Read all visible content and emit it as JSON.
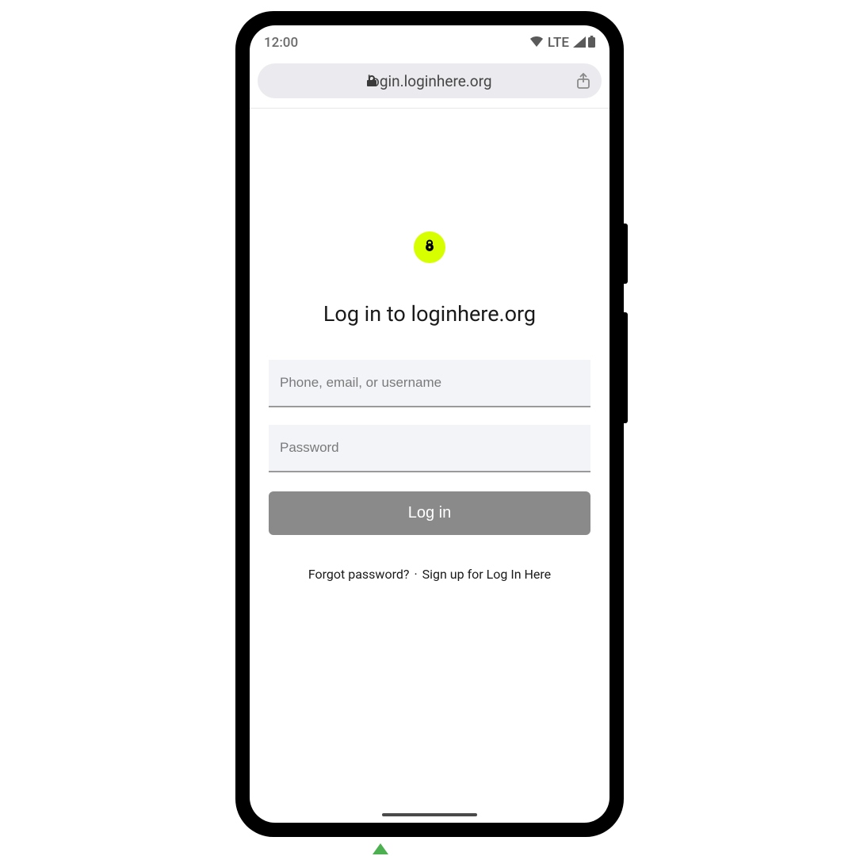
{
  "status_bar": {
    "time": "12:00",
    "network_label": "LTE"
  },
  "address_bar": {
    "url": "login.loginhere.org"
  },
  "icons": {
    "lock": "lock-icon",
    "share": "share-icon",
    "wifi": "wifi-icon",
    "signal": "cell-signal-icon",
    "battery": "battery-icon",
    "logo_lock": "logo-lock-icon"
  },
  "login_form": {
    "title": "Log in to loginhere.org",
    "username_placeholder": "Phone, email, or username",
    "password_placeholder": "Password",
    "submit_label": "Log in"
  },
  "footer": {
    "forgot_password": "Forgot password?",
    "separator": "·",
    "signup": "Sign up for Log In Here"
  },
  "colors": {
    "logo_bg": "#d8ff00",
    "button_bg": "#8a8a8a",
    "input_bg": "#f2f4f8"
  }
}
